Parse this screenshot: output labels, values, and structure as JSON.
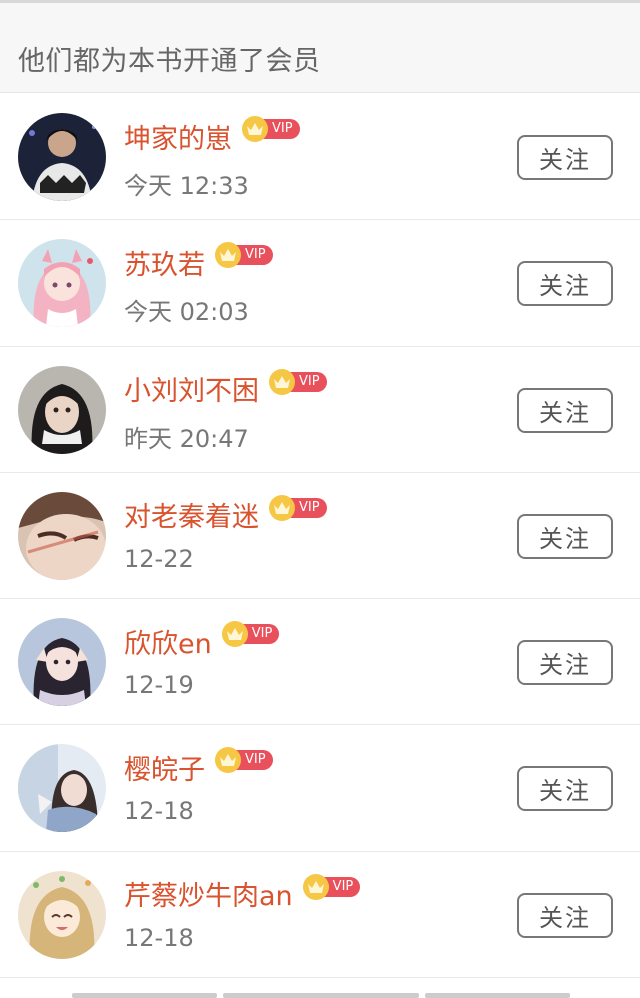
{
  "header": {
    "title": "他们都为本书开通了会员"
  },
  "vip_label": "VIP",
  "members": [
    {
      "name": "坤家的崽",
      "time": "今天 12:33",
      "follow_label": "关注",
      "avatar": "avatar-dark-stage"
    },
    {
      "name": "苏玖若",
      "time": "今天 02:03",
      "follow_label": "关注",
      "avatar": "avatar-anime-pink"
    },
    {
      "name": "小刘刘不困",
      "time": "昨天 20:47",
      "follow_label": "关注",
      "avatar": "avatar-portrait-dark"
    },
    {
      "name": "对老秦着迷",
      "time": "12-22",
      "follow_label": "关注",
      "avatar": "avatar-closeup-face"
    },
    {
      "name": "欣欣en",
      "time": "12-19",
      "follow_label": "关注",
      "avatar": "avatar-girl-braids"
    },
    {
      "name": "樱皖子",
      "time": "12-18",
      "follow_label": "关注",
      "avatar": "avatar-girl-window"
    },
    {
      "name": "芹蔡炒牛肉an",
      "time": "12-18",
      "follow_label": "关注",
      "avatar": "avatar-anime-blonde"
    }
  ],
  "colors": {
    "name": "#d9532f",
    "vip_tag": "#e8505b",
    "crown": "#f6c744",
    "header_bg": "#f7f7f7"
  }
}
